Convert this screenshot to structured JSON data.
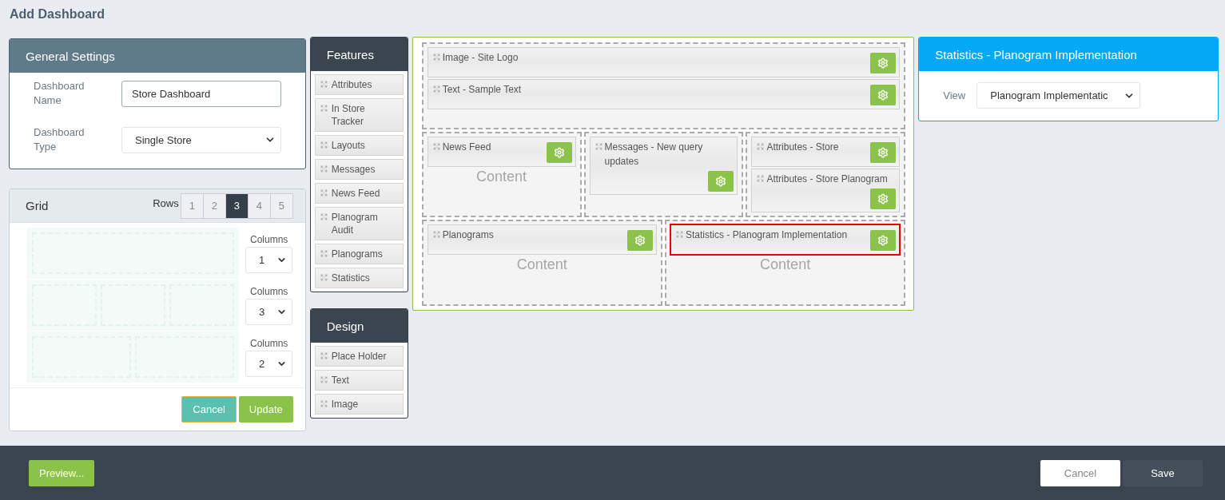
{
  "page": {
    "title": "Add Dashboard"
  },
  "general_settings": {
    "title": "General Settings",
    "fields": [
      {
        "kind": "text",
        "label": "Dashboard Name",
        "value": "Store Dashboard"
      },
      {
        "kind": "select",
        "label": "Dashboard Type",
        "value": "Single Store"
      }
    ]
  },
  "grid": {
    "title": "Grid",
    "rows_label": "Rows",
    "row_options": [
      {
        "label": "1",
        "selected": false
      },
      {
        "label": "2",
        "selected": false
      },
      {
        "label": "3",
        "selected": true
      },
      {
        "label": "4",
        "selected": false
      },
      {
        "label": "5",
        "selected": false
      }
    ],
    "rows": [
      {
        "columns_label": "Columns",
        "value": "1"
      },
      {
        "columns_label": "Columns",
        "value": "3"
      },
      {
        "columns_label": "Columns",
        "value": "2"
      }
    ],
    "buttons": [
      {
        "kind": "secondary",
        "label": "Cancel"
      },
      {
        "kind": "primary",
        "label": "Update"
      }
    ]
  },
  "features": {
    "title": "Features",
    "items": [
      "Attributes",
      "In Store Tracker",
      "Layouts",
      "Messages",
      "News Feed",
      "Planogram Audit",
      "Planograms",
      "Statistics"
    ]
  },
  "design": {
    "title": "Design",
    "items": [
      "Place Holder",
      "Text",
      "Image"
    ]
  },
  "canvas": {
    "rows": [
      {
        "cells": [
          {
            "widgets": [
              {
                "title": "Image - Site Logo",
                "selected": false
              },
              {
                "title": "Text - Sample Text",
                "selected": false
              }
            ]
          }
        ]
      },
      {
        "cells": [
          {
            "watermark_text": "Content",
            "widgets": [
              {
                "title": "News Feed",
                "selected": false
              }
            ]
          },
          {
            "widgets": [
              {
                "title": "Messages - New query updates",
                "selected": false
              }
            ]
          },
          {
            "widgets": [
              {
                "title": "Attributes - Store",
                "selected": false
              },
              {
                "title": "Attributes - Store Planogram",
                "selected": false
              }
            ]
          }
        ]
      },
      {
        "cells": [
          {
            "watermark_text": "Content",
            "widgets": [
              {
                "title": "Planograms",
                "selected": false
              }
            ]
          },
          {
            "watermark_text": "Content",
            "widgets": [
              {
                "title": "Statistics - Planogram Implementation",
                "selected": true
              }
            ]
          }
        ]
      }
    ]
  },
  "properties": {
    "title": "Statistics - Planogram Implementation",
    "fields": [
      {
        "label": "View",
        "value": "Planogram Implementatic"
      }
    ]
  },
  "footer": {
    "buttons": [
      {
        "kind": "preview",
        "label": "Preview..."
      },
      {
        "kind": "cancel",
        "label": "Cancel"
      },
      {
        "kind": "save",
        "label": "Save"
      }
    ]
  }
}
